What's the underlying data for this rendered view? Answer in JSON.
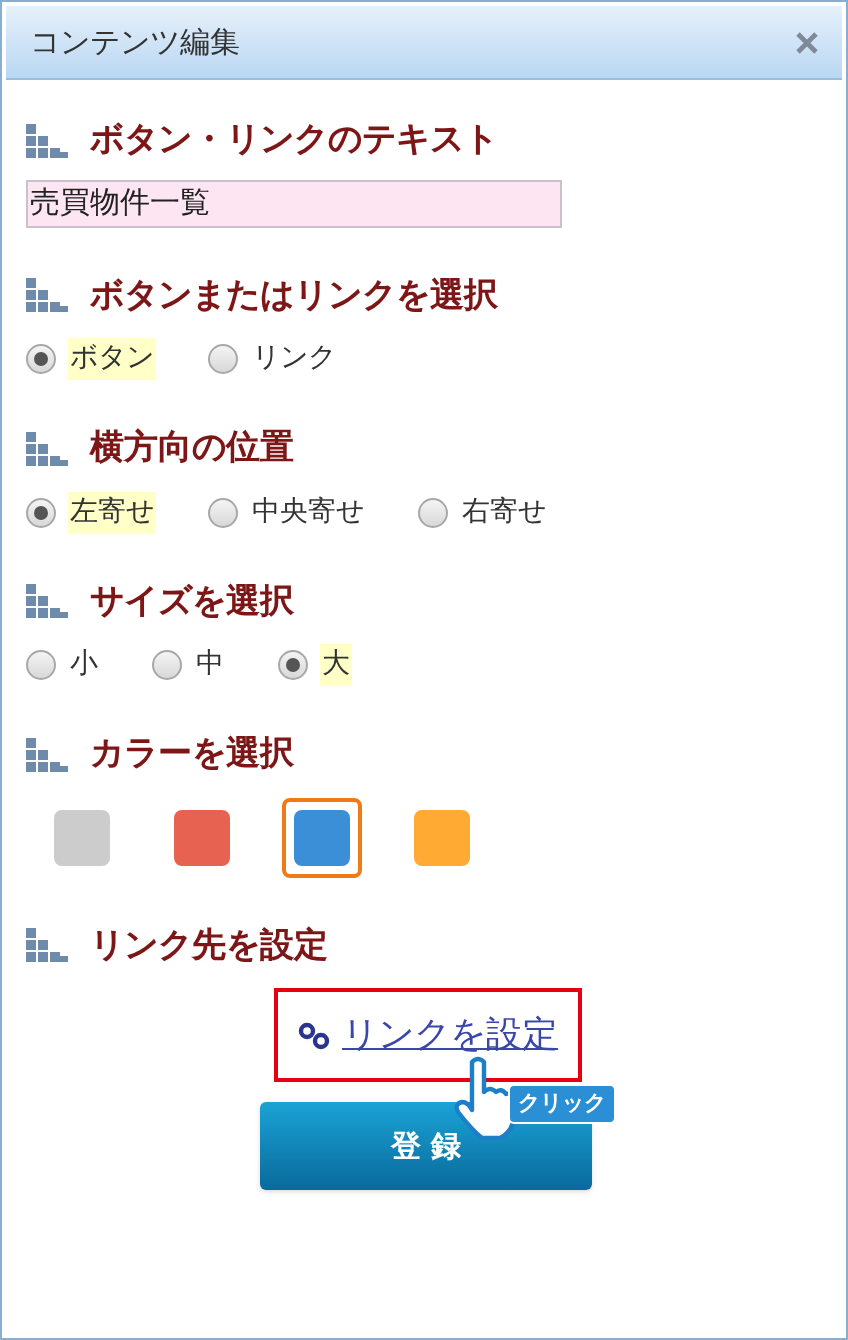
{
  "window": {
    "title": "コンテンツ編集"
  },
  "sections": [
    {
      "kind": "text",
      "heading": "ボタン・リンクのテキスト",
      "value": "売買物件一覧"
    },
    {
      "kind": "radio",
      "heading": "ボタンまたはリンクを選択",
      "options": [
        {
          "label": "ボタン",
          "selected": true
        },
        {
          "label": "リンク",
          "selected": false
        }
      ]
    },
    {
      "kind": "radio",
      "heading": "横方向の位置",
      "options": [
        {
          "label": "左寄せ",
          "selected": true
        },
        {
          "label": "中央寄せ",
          "selected": false
        },
        {
          "label": "右寄せ",
          "selected": false
        }
      ]
    },
    {
      "kind": "radio",
      "heading": "サイズを選択",
      "options": [
        {
          "label": "小",
          "selected": false
        },
        {
          "label": "中",
          "selected": false
        },
        {
          "label": "大",
          "selected": true
        }
      ]
    },
    {
      "kind": "color",
      "heading": "カラーを選択",
      "swatches": [
        {
          "color": "#cccccc",
          "selected": false
        },
        {
          "color": "#e86252",
          "selected": false
        },
        {
          "color": "#3a8fd6",
          "selected": true
        },
        {
          "color": "#ffab33",
          "selected": false
        }
      ]
    },
    {
      "kind": "link",
      "heading": "リンク先を設定",
      "link": "リンクを設定",
      "callout": "クリック"
    }
  ],
  "submit": "登 録"
}
